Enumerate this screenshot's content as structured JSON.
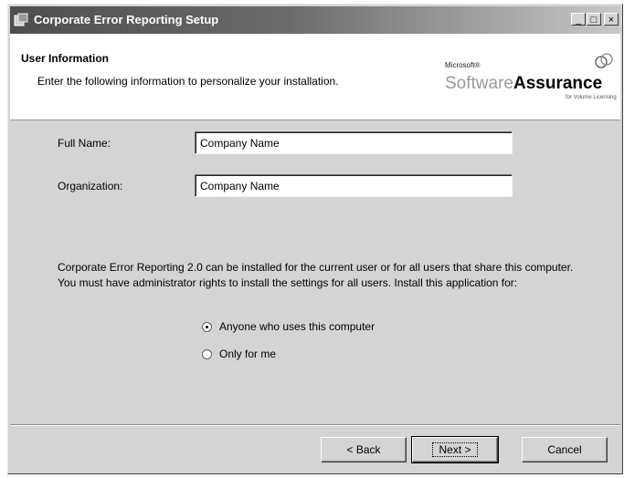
{
  "window": {
    "title": "Corporate Error Reporting Setup",
    "controls": {
      "minimize": "_",
      "maximize": "□",
      "close": "×"
    }
  },
  "header": {
    "title": "User Information",
    "description": "Enter the following information to personalize your installation.",
    "logo": {
      "brand": "Microsoft®",
      "software": "Software",
      "assurance": "Assurance",
      "subtitle": "for Volume Licensing"
    }
  },
  "form": {
    "full_name_label": "Full Name:",
    "full_name_value": "Company Name",
    "organization_label": "Organization:",
    "organization_value": "Company Name"
  },
  "install_info": "Corporate Error Reporting 2.0 can be installed for the current user or for all users that share this computer. You must have administrator rights to install the settings for all users. Install this application for:",
  "options": [
    {
      "label": "Anyone who uses this computer",
      "selected": true
    },
    {
      "label": "Only for me",
      "selected": false
    }
  ],
  "buttons": {
    "back": "< Back",
    "next": "Next >",
    "cancel": "Cancel"
  }
}
